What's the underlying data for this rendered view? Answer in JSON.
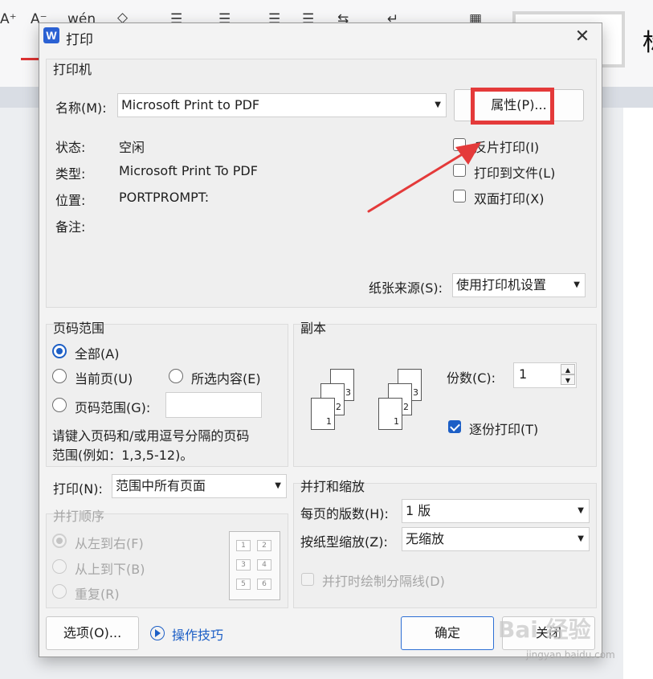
{
  "background": {
    "toolbar_glyphs": [
      "A⁺",
      "A⁻",
      "wén",
      "◇",
      "☰",
      "☰",
      "☰",
      "☰",
      "⇆",
      "↵",
      "▦"
    ]
  },
  "dialog": {
    "title": "打印",
    "app_logo": "W",
    "close_glyph": "✕",
    "printer": {
      "group_title": "打印机",
      "name_label": "名称(M):",
      "name_value": "Microsoft Print to PDF",
      "properties_button": "属性(P)...",
      "status_label": "状态:",
      "status_value": "空闲",
      "type_label": "类型:",
      "type_value": "Microsoft Print To PDF",
      "location_label": "位置:",
      "location_value": "PORTPROMPT:",
      "comment_label": "备注:",
      "reverse_print": "反片打印(I)",
      "print_to_file": "打印到文件(L)",
      "duplex": "双面打印(X)",
      "paper_source_label": "纸张来源(S):",
      "paper_source_value": "使用打印机设置"
    },
    "page_range": {
      "group_title": "页码范围",
      "all": "全部(A)",
      "current": "当前页(U)",
      "selection": "所选内容(E)",
      "pages": "页码范围(G):",
      "hint_line1": "请键入页码和/或用逗号分隔的页码",
      "hint_line2": "范围(例如：1,3,5-12)。"
    },
    "copies": {
      "group_title": "副本",
      "count_label": "份数(C):",
      "count_value": "1",
      "collate": "逐份打印(T)",
      "sheet_numbers": [
        "3",
        "2",
        "1"
      ]
    },
    "print_what": {
      "label": "打印(N):",
      "value": "范围中所有页面"
    },
    "order": {
      "group_title": "并打顺序",
      "left_to_right": "从左到右(F)",
      "top_to_bottom": "从上到下(B)",
      "repeat": "重复(R)",
      "grid_numbers": [
        "1",
        "2",
        "3",
        "4",
        "5",
        "6"
      ]
    },
    "zoom": {
      "group_title": "并打和缩放",
      "pages_per_sheet_label": "每页的版数(H):",
      "pages_per_sheet_value": "1 版",
      "scale_label": "按纸型缩放(Z):",
      "scale_value": "无缩放",
      "draw_borders": "并打时绘制分隔线(D)"
    },
    "footer": {
      "options_button": "选项(O)...",
      "tips_link": "操作技巧",
      "ok_button": "确定",
      "close_button": "关闭"
    }
  },
  "watermark": {
    "text": "Bai 经验",
    "url": "jingyan.baidu.com"
  },
  "colors": {
    "accent": "#1d5fc6",
    "highlight_red": "#e43a3a"
  }
}
